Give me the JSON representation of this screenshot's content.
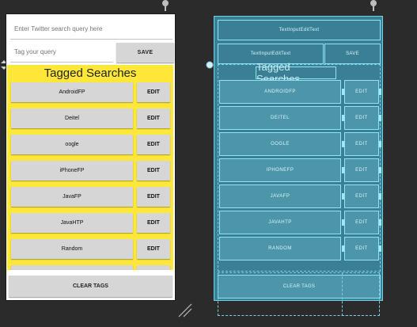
{
  "design": {
    "search_placeholder": "Enter Twitter search query here",
    "tag_placeholder": "Tag your query",
    "save_label": "SAVE",
    "tagged_title": "Tagged Searches",
    "edit_label": "EDIT",
    "clear_label": "CLEAR TAGS",
    "tags": [
      "AndroidFP",
      "Deitel",
      "oogle",
      "iPhoneFP",
      "JavaFP",
      "JavaHTP",
      "Random"
    ]
  },
  "blueprint": {
    "edittext_label": "TextInputEditText",
    "save_label": "SAVE",
    "tagged_title": "Tagged Searches",
    "edit_label": "EDIT",
    "clear_label": "CLEAR TAGS",
    "tags": [
      "ANDROIDFP",
      "DEITEL",
      "OOGLE",
      "IPHONEFP",
      "JAVAFP",
      "JAVAHTP",
      "RANDOM"
    ]
  },
  "colors": {
    "canvas": "#2b2b2b",
    "tag_panel": "#ffe739",
    "button": "#d6d6d6",
    "blueprint_bg": "#3a7f93",
    "blueprint_line": "#8ee4f7"
  }
}
